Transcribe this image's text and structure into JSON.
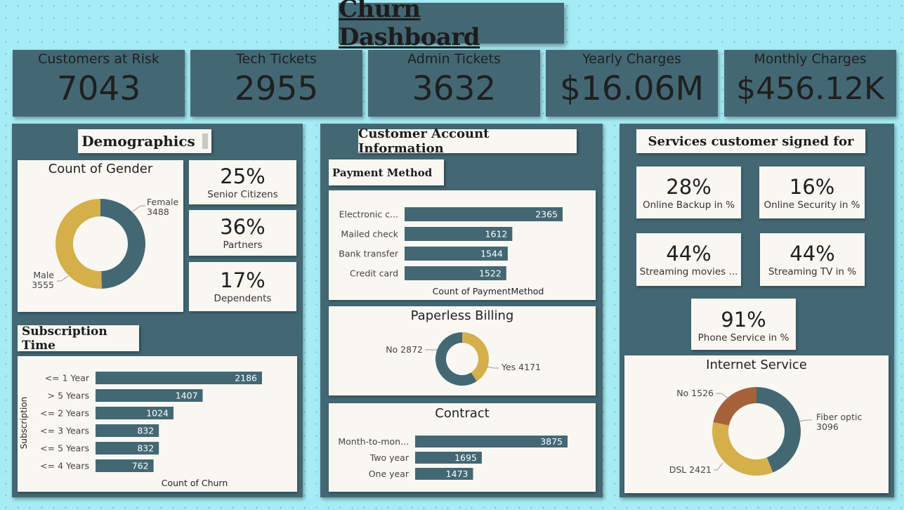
{
  "title": "Churn Dashboard",
  "kpis": [
    {
      "label": "Customers at Risk",
      "value": "7043"
    },
    {
      "label": "Tech Tickets",
      "value": "2955"
    },
    {
      "label": "Admin Tickets",
      "value": "3632"
    },
    {
      "label": "Yearly Charges",
      "value": "$16.06M"
    },
    {
      "label": "Monthly Charges",
      "value": "$456.12K"
    }
  ],
  "demographics": {
    "header": "Demographics",
    "stats": [
      {
        "value": "25%",
        "label": "Senior Citizens"
      },
      {
        "value": "36%",
        "label": "Partners"
      },
      {
        "value": "17%",
        "label": "Dependents"
      }
    ]
  },
  "account": {
    "header": "Customer Account Information",
    "payment_header": "Payment Method"
  },
  "services": {
    "header": "Services customer signed for",
    "stats": [
      {
        "value": "28%",
        "label": "Online Backup in %"
      },
      {
        "value": "16%",
        "label": "Online Security in %"
      },
      {
        "value": "44%",
        "label": "Streaming movies ..."
      },
      {
        "value": "44%",
        "label": "Streaming TV in %"
      },
      {
        "value": "91%",
        "label": "Phone Service in %"
      }
    ]
  },
  "subscription_header": "Subscription Time",
  "colors": {
    "teal": "#436874",
    "gold": "#d4af4a",
    "brown": "#a5613a",
    "bg": "#a6ecf5",
    "card": "#f9f7f2"
  },
  "chart_data": [
    {
      "id": "gender",
      "type": "pie",
      "title": "Count of Gender",
      "categories": [
        "Female",
        "Male"
      ],
      "values": [
        3488,
        3555
      ],
      "colors": [
        "#436874",
        "#d4af4a"
      ]
    },
    {
      "id": "subscription",
      "type": "bar",
      "orientation": "horizontal",
      "title": "",
      "categories": [
        "<= 1 Year",
        "> 5 Years",
        "<= 2 Years",
        "<= 3 Years",
        "<= 5 Years",
        "<= 4 Years"
      ],
      "values": [
        2186,
        1407,
        1024,
        832,
        832,
        762
      ],
      "xlabel": "Count of Churn",
      "ylabel": "Subscription"
    },
    {
      "id": "payment",
      "type": "bar",
      "orientation": "horizontal",
      "title": "",
      "categories": [
        "Electronic c...",
        "Mailed check",
        "Bank transfer",
        "Credit card"
      ],
      "values": [
        2365,
        1612,
        1544,
        1522
      ],
      "xlabel": "Count of PaymentMethod"
    },
    {
      "id": "paperless",
      "type": "pie",
      "title": "Paperless Billing",
      "categories": [
        "No",
        "Yes"
      ],
      "values": [
        2872,
        4171
      ],
      "colors": [
        "#d4af4a",
        "#436874"
      ]
    },
    {
      "id": "contract",
      "type": "bar",
      "orientation": "horizontal",
      "title": "Contract",
      "categories": [
        "Month-to-mon...",
        "Two year",
        "One year"
      ],
      "values": [
        3875,
        1695,
        1473
      ]
    },
    {
      "id": "internet",
      "type": "pie",
      "title": "Internet Service",
      "categories": [
        "Fiber optic",
        "DSL",
        "No"
      ],
      "values": [
        3096,
        2421,
        1526
      ],
      "colors": [
        "#436874",
        "#d4af4a",
        "#a5613a"
      ]
    }
  ]
}
